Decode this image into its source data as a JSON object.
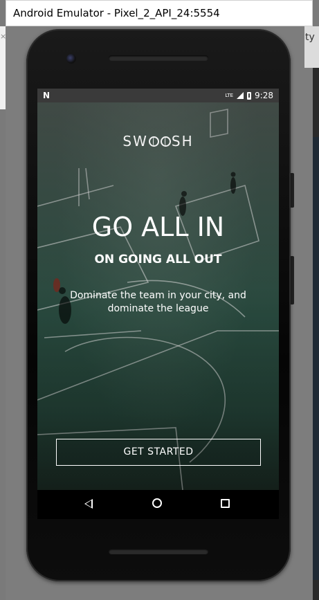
{
  "window": {
    "title": "Android Emulator - Pixel_2_API_24:5554"
  },
  "status_bar": {
    "left_icon": "n-notification-icon",
    "network": "LTE",
    "time": "9:28"
  },
  "app": {
    "logo": {
      "prefix": "SW",
      "suffix": "SH"
    },
    "headline": "GO ALL IN",
    "subheadline": "ON GOING ALL OUT",
    "description": "Dominate the team in your city, and dominate the league",
    "cta_label": "GET STARTED"
  },
  "nav_bar": {
    "icons": [
      "back-icon",
      "home-icon",
      "recents-icon"
    ]
  },
  "background_peek": {
    "right_text": "ty"
  },
  "colors": {
    "court_green": "#2f5548",
    "text": "#ffffff",
    "status_bar": "#3a3a3a",
    "nav_bar": "#000000"
  }
}
